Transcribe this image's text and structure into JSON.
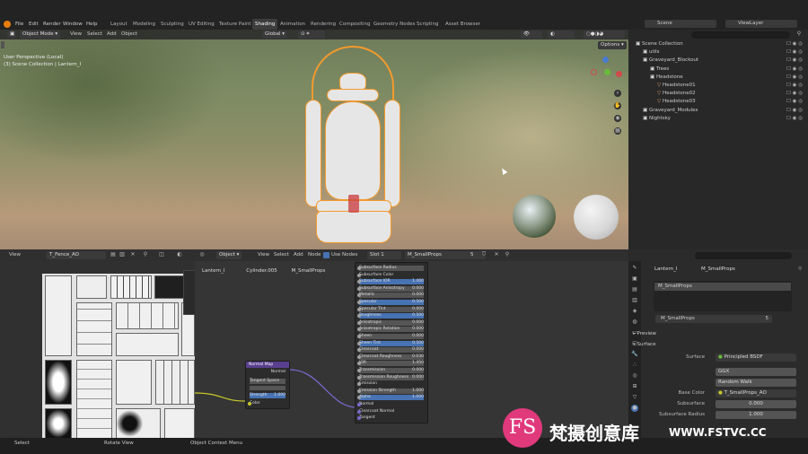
{
  "menu": {
    "items": [
      "File",
      "Edit",
      "Render",
      "Window",
      "Help"
    ]
  },
  "workspaces": {
    "tabs": [
      "Layout",
      "Modeling",
      "Sculpting",
      "UV Editing",
      "Texture Paint",
      "Shading",
      "Animation",
      "Rendering",
      "Compositing",
      "Geometry Nodes",
      "Scripting",
      "Asset Browser"
    ],
    "active": "Shading"
  },
  "scene": {
    "name": "Scene",
    "view_layer": "ViewLayer"
  },
  "viewport": {
    "mode": "Object Mode",
    "menus": [
      "View",
      "Select",
      "Add",
      "Object"
    ],
    "transform": "Global",
    "options": "Options",
    "info_line1": "User Perspective (Local)",
    "info_line2": "(3) Scene Collection | Lantern_I"
  },
  "outliner": {
    "rows": [
      {
        "label": "Scene Collection",
        "indent": 0
      },
      {
        "label": "utils",
        "indent": 1
      },
      {
        "label": "Graveyard_Blockout",
        "indent": 1
      },
      {
        "label": "Trees",
        "indent": 2
      },
      {
        "label": "Headstone",
        "indent": 2
      },
      {
        "label": "Headstone01",
        "indent": 3
      },
      {
        "label": "Headstone02",
        "indent": 3
      },
      {
        "label": "Headstone03",
        "indent": 3
      },
      {
        "label": "Graveyard_Modules",
        "indent": 1
      },
      {
        "label": "Nightsky",
        "indent": 1
      }
    ]
  },
  "image_editor": {
    "menu": "View",
    "image_name": "T_Fence_AO"
  },
  "node_editor": {
    "object_mode": "Object",
    "menus": [
      "View",
      "Select",
      "Add",
      "Node"
    ],
    "use_nodes": "Use Nodes",
    "slot": "Slot 1",
    "material": "M_SmallProps",
    "users": "5",
    "breadcrumb": [
      "Lantern_I",
      "Cylinder.005",
      "M_SmallProps"
    ],
    "normal_map": {
      "title": "Normal Map",
      "out": "Normal",
      "space": "Tangent Space",
      "strength_label": "Strength",
      "strength": "1.000",
      "in": "Color"
    },
    "bsdf_rows": [
      {
        "label": "Subsurface Radius",
        "style": "dd"
      },
      {
        "label": "Subsurface Color",
        "style": "plain"
      },
      {
        "label": "Subsurface IOR",
        "value": "1.400",
        "style": "blue"
      },
      {
        "label": "Subsurface Anisotropy",
        "value": "0.000",
        "style": "bar"
      },
      {
        "label": "Metallic",
        "value": "0.000",
        "style": "bar"
      },
      {
        "label": "Specular",
        "value": "0.500",
        "style": "blue"
      },
      {
        "label": "Specular Tint",
        "value": "0.000",
        "style": "bar"
      },
      {
        "label": "Roughness",
        "value": "0.500",
        "style": "blue"
      },
      {
        "label": "Anisotropic",
        "value": "0.000",
        "style": "bar"
      },
      {
        "label": "Anisotropic Rotation",
        "value": "0.000",
        "style": "bar"
      },
      {
        "label": "Sheen",
        "value": "0.000",
        "style": "bar"
      },
      {
        "label": "Sheen Tint",
        "value": "0.500",
        "style": "blue"
      },
      {
        "label": "Clearcoat",
        "value": "0.000",
        "style": "bar"
      },
      {
        "label": "Clearcoat Roughness",
        "value": "0.030",
        "style": "bar"
      },
      {
        "label": "IOR",
        "value": "1.450",
        "style": "bar"
      },
      {
        "label": "Transmission",
        "value": "0.000",
        "style": "bar"
      },
      {
        "label": "Transmission Roughness",
        "value": "0.000",
        "style": "bar"
      },
      {
        "label": "Emission",
        "style": "plain"
      },
      {
        "label": "Emission Strength",
        "value": "1.000",
        "style": "bar"
      },
      {
        "label": "Alpha",
        "value": "1.000",
        "style": "blue"
      },
      {
        "label": "Normal",
        "style": "plain"
      },
      {
        "label": "Clearcoat Normal",
        "style": "plain"
      },
      {
        "label": "Tangent",
        "style": "plain"
      }
    ]
  },
  "properties": {
    "breadcrumb_obj": "Lantern_I",
    "breadcrumb_mat": "M_SmallProps",
    "slot_material": "M_SmallProps",
    "material_field": "M_SmallProps",
    "users": "5",
    "preview": "Preview",
    "surface_section": "Surface",
    "surface_label": "Surface",
    "surface_value": "Principled BSDF",
    "distribution": "GGX",
    "subsurface_method": "Random Walk",
    "base_color_label": "Base Color",
    "base_color_value": "T_SmallProps_AO",
    "subsurface_label": "Subsurface",
    "subsurface_value": "0.000",
    "subsurface_radius_label": "Subsurface Radius",
    "subsurface_radius_value": "1.000"
  },
  "status": {
    "select": "Select",
    "rotate": "Rotate View",
    "context": "Object Context Menu"
  },
  "watermark": {
    "logo": "FS",
    "text": "梵摄创意库",
    "url": "WWW.FSTVC.CC"
  }
}
